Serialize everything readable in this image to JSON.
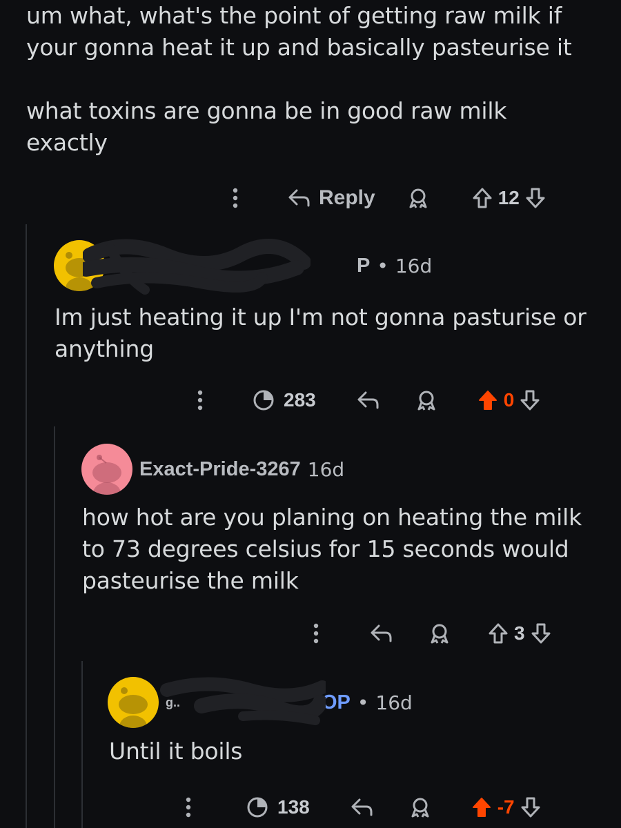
{
  "comment1": {
    "text_line1": "um what, what's the point of getting raw milk if",
    "text_line2": "your gonna heat it up and basically pasteurise it",
    "text_line3": "what toxins are gonna be in good raw milk",
    "text_line4": "exactly",
    "reply_label": "Reply",
    "votes": "12"
  },
  "comment2": {
    "username_visible": "P",
    "separator": "•",
    "age": "16d",
    "text_line1": "Im just heating it up I'm not gonna pasturise or",
    "text_line2": "anything",
    "views": "283",
    "votes": "0"
  },
  "comment3": {
    "username": "Exact-Pride-3267",
    "age": "16d",
    "text_line1": "how hot are you planing on heating the milk",
    "text_line2": "to 73 degrees celsius for 15 seconds would",
    "text_line3": "pasteurise the milk",
    "votes": "3"
  },
  "comment4": {
    "username_visible": "g..",
    "op_label": "OP",
    "separator": "•",
    "age": "16d",
    "text_line1": "Until it boils",
    "views": "138",
    "votes": "-7"
  },
  "colors": {
    "background": "#0d0e11",
    "text": "#d7dadc",
    "upvoted": "#ff4500",
    "op": "#6f9cff",
    "avatar_yellow": "#f2c100",
    "avatar_pink": "#f58b98"
  }
}
